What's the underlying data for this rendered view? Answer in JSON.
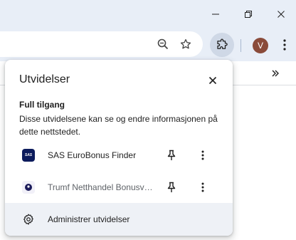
{
  "window": {
    "buttons": [
      "minimize",
      "restore",
      "close"
    ]
  },
  "toolbar": {
    "avatar_letter": "V",
    "icons": [
      "zoom-icon",
      "star-icon",
      "puzzle-icon",
      "kebab-menu-icon"
    ]
  },
  "bookmarks_bar": {
    "overflow_icon": "double-chevron-right-icon"
  },
  "popup": {
    "title": "Utvidelser",
    "section_title": "Full tilgang",
    "section_description": "Disse utvidelsene kan se og endre informasjonen på dette nettstedet.",
    "extensions": [
      {
        "name": "SAS EuroBonus Finder",
        "logo_text": "SAS"
      },
      {
        "name": "Trumf Netthandel Bonusvarsler",
        "logo_text": ""
      }
    ],
    "footer_label": "Administrer utvidelser"
  },
  "colors": {
    "chrome_bg": "#e8eef7",
    "active_ext_bg": "#cfd8e6",
    "avatar_bg": "#8a4b3a",
    "footer_bg": "#eef1f6",
    "sas_logo": "#0c1b5c",
    "trumf_logo": "#1b1b5a"
  }
}
